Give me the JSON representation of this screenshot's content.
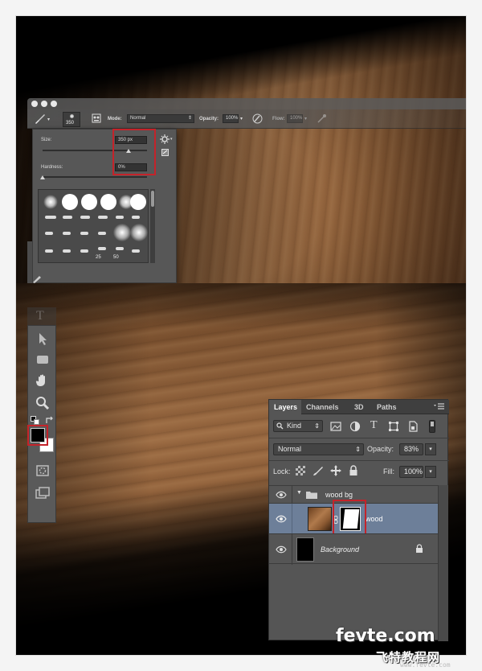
{
  "options_bar": {
    "brush_size_readout": "350",
    "mode_label": "Mode:",
    "mode_value": "Normal",
    "opacity_label": "Opacity:",
    "opacity_value": "100%",
    "flow_label": "Flow:",
    "flow_value": "100%"
  },
  "brush_picker": {
    "size_label": "Size:",
    "size_value": "350 px",
    "hardness_label": "Hardness:",
    "hardness_value": "0%",
    "preset_labels": [
      "25",
      "50"
    ]
  },
  "toolbox": {
    "type_tool_glyph": "T"
  },
  "layers_panel": {
    "tabs": [
      "Layers",
      "Channels",
      "3D",
      "Paths"
    ],
    "active_tab": "Layers",
    "filter_kind": "Kind",
    "blend_mode": "Normal",
    "opacity_label": "Opacity:",
    "opacity_value": "83%",
    "lock_label": "Lock:",
    "fill_label": "Fill:",
    "fill_value": "100%",
    "layers": [
      {
        "name": "wood bg",
        "type": "group",
        "visible": true
      },
      {
        "name": "wood",
        "type": "layer-with-mask",
        "visible": true,
        "selected": true
      },
      {
        "name": "Background",
        "type": "background",
        "visible": true,
        "locked": true
      }
    ]
  },
  "watermark": {
    "line1": "fevte.com",
    "line2": "飞特教程网",
    "line3": "www.fevte.com"
  },
  "colors": {
    "highlight_red": "#c4232a",
    "selected_layer": "#6d7f99",
    "panel_gray": "#555555"
  }
}
